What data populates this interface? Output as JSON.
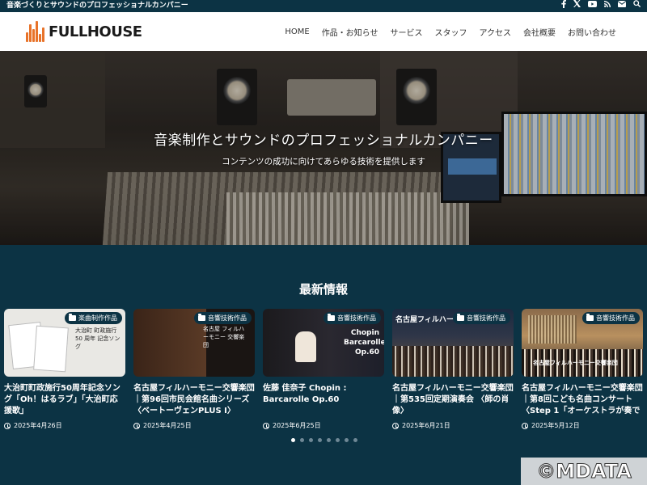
{
  "topbar": {
    "tagline": "音楽づくりとサウンドのプロフェッショナルカンパニー",
    "social_icons": [
      "facebook-icon",
      "x-icon",
      "youtube-icon",
      "rss-icon",
      "mail-icon",
      "search-icon"
    ]
  },
  "header": {
    "logo_text": "FULLHOUSE",
    "brand_color": "#e8732a",
    "nav": [
      "HOME",
      "作品・お知らせ",
      "サービス",
      "スタッフ",
      "アクセス",
      "会社概要",
      "お問い合わせ"
    ]
  },
  "hero": {
    "title": "音楽制作とサウンドのプロフェッショナルカンパニー",
    "subtitle": "コンテンツの成功に向けてあらゆる技術を提供します"
  },
  "news": {
    "heading": "最新情報",
    "cards": [
      {
        "category": "楽曲制作作品",
        "title": "大治町町政施行50周年記念ソング「Oh！はるラブ」「大治町応援歌」",
        "date": "2025年4月26日",
        "thumb_text": "大治町 町政施行 50 周年 記念ソング"
      },
      {
        "category": "音響技術作品",
        "title": "名古屋フィルハーモニー交響楽団｜第96回市民会館名曲シリーズ〈ベートーヴェンPLUS I〉",
        "date": "2025年4月25日",
        "thumb_text": "名古屋 フィルハーモニー 交響楽団"
      },
      {
        "category": "音響技術作品",
        "title": "佐藤 佳奈子 Chopin : Barcarolle Op.60",
        "date": "2025年6月25日",
        "thumb_text": "Chopin Barcarolle Op.60"
      },
      {
        "category": "音響技術作品",
        "title": "名古屋フィルハーモニー交響楽団｜第535回定期演奏会 〈師の肖像〉",
        "date": "2025年6月21日",
        "thumb_text": "名古屋フィルハーモニー交響楽団"
      },
      {
        "category": "音響技術作品",
        "title": "名古屋フィルハーモニー交響楽団｜第8回こども名曲コンサート〈Step 1「オーケストラが奏で",
        "date": "2025年5月12日",
        "thumb_text": "名古屋フィルハーモニー交響楽団"
      }
    ],
    "pagination": {
      "total": 8,
      "active": 1
    }
  },
  "watermark": "©MDATA"
}
